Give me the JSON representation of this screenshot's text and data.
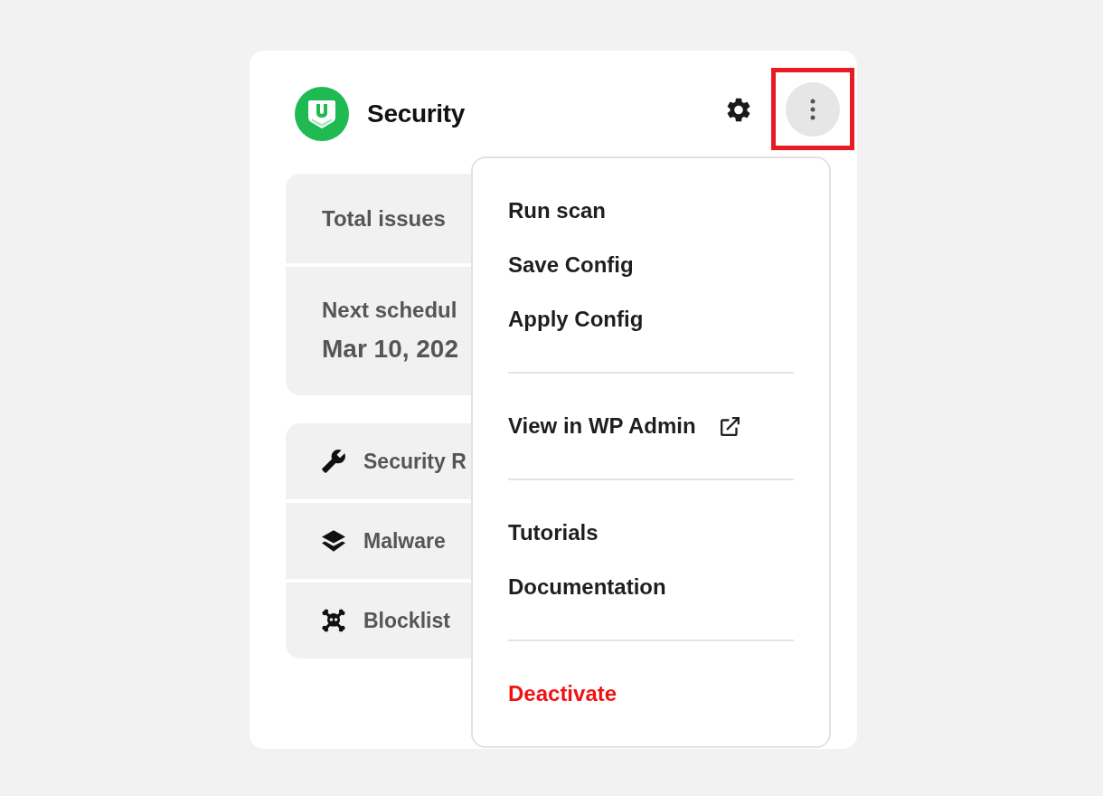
{
  "header": {
    "title": "Security",
    "more_button": {
      "expanded": true,
      "highlighted": true
    }
  },
  "summary": [
    {
      "label": "Total issues"
    },
    {
      "label": "Next schedul",
      "value": "Mar 10, 202"
    }
  ],
  "features": [
    {
      "label": "Security R"
    },
    {
      "label": "Malware"
    },
    {
      "label": "Blocklist"
    }
  ],
  "menu": {
    "groups": [
      {
        "items": [
          {
            "label": "Run scan",
            "kind": "action"
          },
          {
            "label": "Save Config",
            "kind": "action"
          },
          {
            "label": "Apply Config",
            "kind": "action"
          }
        ]
      },
      {
        "items": [
          {
            "label": "View in WP Admin",
            "kind": "external"
          }
        ]
      },
      {
        "items": [
          {
            "label": "Tutorials",
            "kind": "action"
          },
          {
            "label": "Documentation",
            "kind": "action"
          }
        ]
      },
      {
        "items": [
          {
            "label": "Deactivate",
            "kind": "danger"
          }
        ]
      }
    ]
  }
}
